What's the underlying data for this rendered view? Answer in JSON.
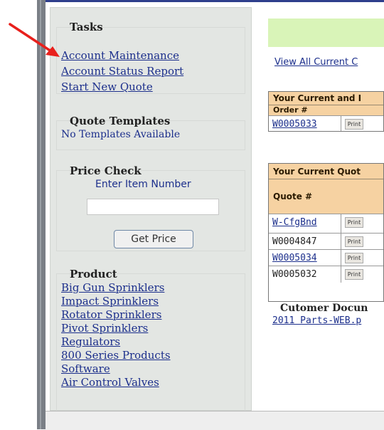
{
  "sidebar": {
    "tasks": {
      "title": "Tasks",
      "links": [
        "Account Maintenance",
        "Account Status Report",
        "Start New Quote"
      ]
    },
    "quote_templates": {
      "title": "Quote Templates",
      "empty_text": "No Templates Available"
    },
    "price_check": {
      "title": "Price Check",
      "prompt": "Enter Item Number",
      "input_value": "",
      "button_label": "Get Price"
    },
    "product": {
      "title": "Product",
      "links": [
        "Big Gun Sprinklers",
        "Impact Sprinklers",
        "Rotator Sprinklers",
        "Pivot Sprinklers",
        "Regulators",
        "800 Series Products",
        "Software",
        "Air Control Valves"
      ]
    }
  },
  "main": {
    "view_all_link": "View All Current C",
    "orders_table": {
      "header": "Your Current and I",
      "column": "Order #",
      "rows": [
        {
          "number": "W0005033",
          "print": "Print"
        }
      ]
    },
    "quotes_table": {
      "header": "Your Current Quot",
      "column": "Quote #",
      "rows": [
        {
          "number": "W-CfgBnd",
          "print": "Print"
        },
        {
          "number": "W0004847",
          "print": "Print"
        },
        {
          "number": "W0005034",
          "print": "Print"
        },
        {
          "number": "W0005032",
          "print": "Print"
        }
      ]
    },
    "customer_docs": {
      "title": "Cutomer Docun",
      "link": "2011 Parts-WEB.p"
    }
  },
  "colors": {
    "sidebar_bg": "#e3e6e3",
    "link": "#1c2f8c",
    "table_header": "#f6d2a2",
    "banner": "#d9f4b8",
    "annotation_arrow": "#e8201c"
  }
}
